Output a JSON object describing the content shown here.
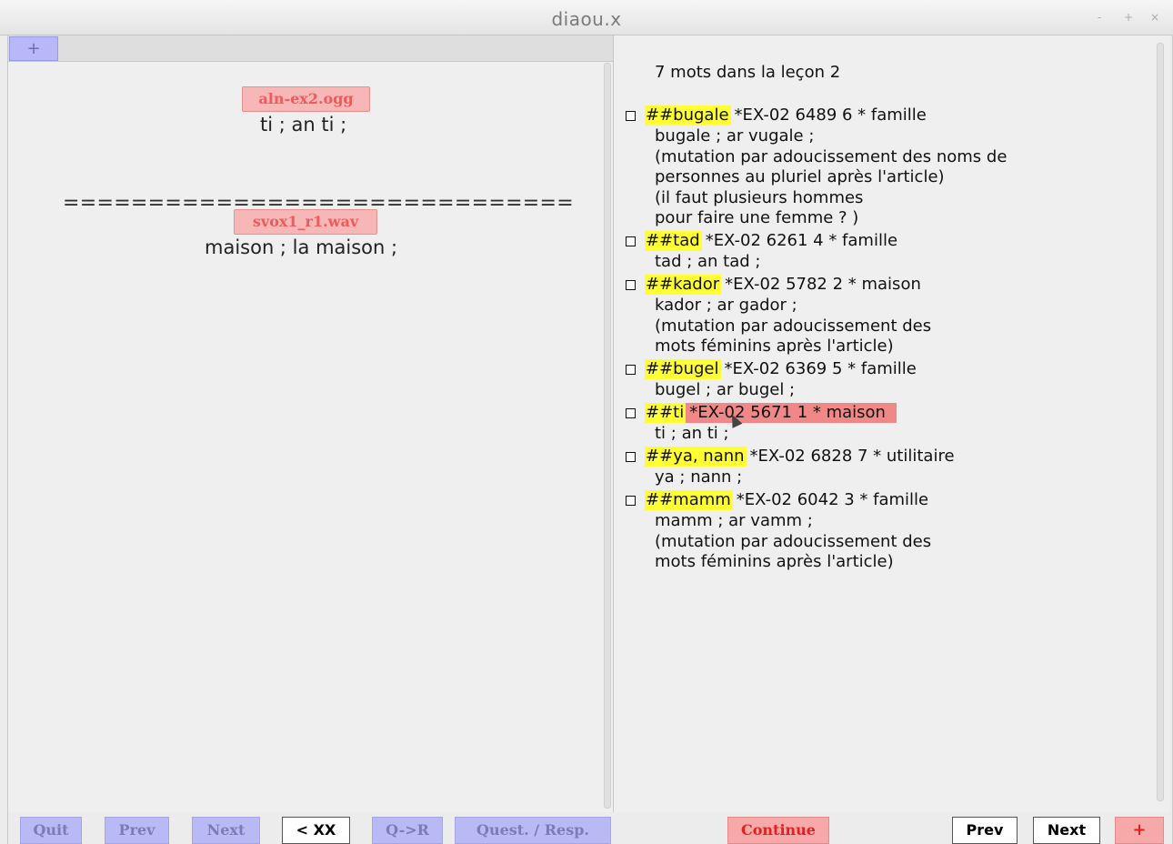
{
  "window": {
    "title": "diaou.x",
    "controls": [
      "-",
      "+",
      "×"
    ]
  },
  "left": {
    "tab_plus": "+",
    "question": {
      "audio_label": "aln-ex2.ogg",
      "text": "ti ; an ti ;"
    },
    "separator": "==============================",
    "answer": {
      "audio_label": "svox1_r1.wav",
      "text": "maison ; la maison ;"
    }
  },
  "right": {
    "header": "7  mots dans la leçon  2",
    "entries": [
      {
        "tag": "##bugale",
        "info": "*EX-02 6489  6 * famille",
        "lines": [
          "bugale ; ar vugale ;",
          "(mutation par adoucissement des noms de",
          "personnes au pluriel après l'article)",
          "(il faut plusieurs hommes",
          "pour faire une femme ? )"
        ]
      },
      {
        "tag": "##tad",
        "info": "*EX-02 6261  4 * famille",
        "lines": [
          "tad ; an tad ;"
        ]
      },
      {
        "tag": "##kador",
        "info": "*EX-02 5782  2 * maison",
        "lines": [
          "kador ; ar gador ;",
          "(mutation par adoucissement des",
          "mots féminins après l'article)"
        ]
      },
      {
        "tag": "##bugel",
        "info": "*EX-02 6369  5 * famille",
        "lines": [
          "bugel ; ar bugel ;"
        ]
      },
      {
        "tag": "##ti",
        "info": "*EX-02 5671  1 * maison",
        "lines": [
          "ti ; an ti ;"
        ],
        "active": true
      },
      {
        "tag": "##ya, nann",
        "info": "*EX-02 6828  7 * utilitaire",
        "lines": [
          "ya ; nann ;"
        ]
      },
      {
        "tag": "##mamm",
        "info": "*EX-02 6042  3 * famille",
        "lines": [
          "mamm ; ar vamm ;",
          "(mutation par adoucissement des",
          "mots féminins après l'article)"
        ]
      }
    ]
  },
  "buttons": {
    "quit": "Quit",
    "prev_left": "Prev",
    "next_left": "Next",
    "xx": "< XX",
    "q_to_r": "Q->R",
    "quest_resp": "Quest. / Resp.",
    "continue": "Continue",
    "prev_right": "Prev",
    "next_right": "Next",
    "plus": "+"
  },
  "colors": {
    "highlight_tag": "#ffff33",
    "active_entry": "#f08888",
    "disabled_button": "#b9b9f6",
    "audio_chip": "#f7b7b7"
  }
}
